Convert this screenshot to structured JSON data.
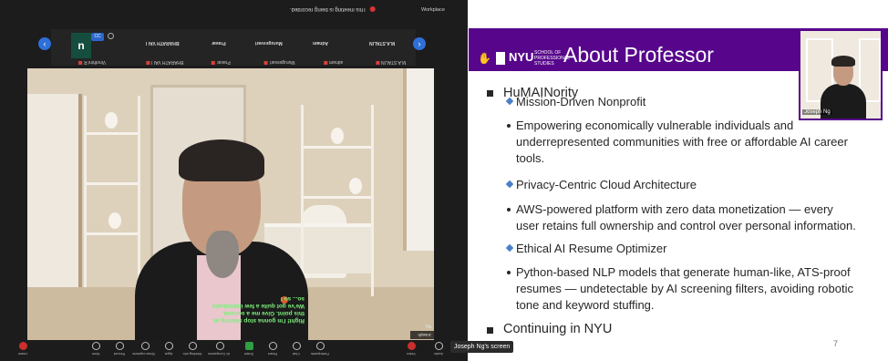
{
  "meeting": {
    "recording_text": "This meeting is being recorded.",
    "corner_title": "Workplace",
    "cc_badge": "CC",
    "self_initial": "n",
    "participants_top": [
      "M.A.STALIN",
      "Adnam",
      "Murugesvari",
      "Pravar",
      "BHARATH VAI I"
    ],
    "participants_bottom": [
      "M.A.STALIN",
      "adnam",
      "Murugesvari",
      "Pravar",
      "BHARATH VAI I",
      "Vinothini R"
    ],
    "caption_text": "Right! I'm gonna stop sharing at this point. Give me a second. We've got quite a few individuals so... so I",
    "video_label": "Joseph Ng",
    "controls": [
      "Audio",
      "Video",
      "Participants",
      "Chat",
      "React",
      "Share",
      "AI Companion",
      "Meeting info",
      "Apps",
      "Show captions",
      "Record",
      "More",
      "Leave"
    ]
  },
  "slide": {
    "logo_word": "NYU",
    "logo_sub": "SCHOOL OF PROFESSIONAL STUDIES",
    "title": "About Professor",
    "pip_name": "Joseph Ng",
    "heading": "HuMAINority",
    "items": [
      "Mission-Driven Nonprofit",
      "Empowering economically vulnerable individuals and",
      "underrepresented communities with free or affordable AI career",
      "tools.",
      "Privacy-Centric Cloud Architecture",
      "AWS-powered platform with zero data monetization — every",
      "user retains full ownership and control over personal information.",
      "Ethical AI Resume Optimizer",
      "Python-based NLP models that generate human-like, ATS-proof",
      "resumes — undetectable by AI screening filters, avoiding robotic",
      "tone and keyword stuffing."
    ],
    "footer_heading": "Continuing in NYU",
    "page_number": "7"
  },
  "share_label": "Joseph Ng's screen",
  "colors": {
    "nyu_purple": "#57068c",
    "accent_blue": "#2e6fd8",
    "caption_green": "#7cf07c"
  }
}
